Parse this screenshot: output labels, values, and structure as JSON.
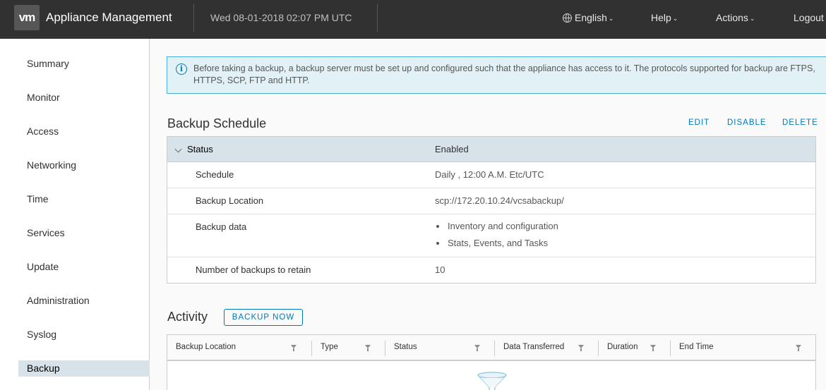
{
  "header": {
    "logo": "vm",
    "app_title": "Appliance Management",
    "datetime": "Wed 08-01-2018 02:07 PM UTC",
    "nav": {
      "language": "English",
      "help": "Help",
      "actions": "Actions",
      "logout": "Logout"
    }
  },
  "sidebar": {
    "items": [
      {
        "label": "Summary"
      },
      {
        "label": "Monitor"
      },
      {
        "label": "Access"
      },
      {
        "label": "Networking"
      },
      {
        "label": "Time"
      },
      {
        "label": "Services"
      },
      {
        "label": "Update"
      },
      {
        "label": "Administration"
      },
      {
        "label": "Syslog"
      },
      {
        "label": "Backup"
      }
    ],
    "active": "Backup"
  },
  "alert": {
    "text": "Before taking a backup, a backup server must be set up and configured such that the appliance has access to it. The protocols supported for backup are FTPS, HTTPS, SCP, FTP and HTTP."
  },
  "backup_schedule": {
    "title": "Backup Schedule",
    "actions": {
      "edit": "EDIT",
      "disable": "DISABLE",
      "delete": "DELETE"
    },
    "status_label": "Status",
    "status_value": "Enabled",
    "rows": {
      "schedule": {
        "label": "Schedule",
        "value": "Daily , 12:00 A.M. Etc/UTC"
      },
      "location": {
        "label": "Backup Location",
        "value": "scp://172.20.10.24/vcsabackup/"
      },
      "data": {
        "label": "Backup data",
        "values": [
          "Inventory and configuration",
          "Stats, Events, and Tasks"
        ]
      },
      "retain": {
        "label": "Number of backups to retain",
        "value": "10"
      }
    }
  },
  "activity": {
    "title": "Activity",
    "backup_now": "BACKUP NOW",
    "columns": [
      "Backup Location",
      "Type",
      "Status",
      "Data Transferred",
      "Duration",
      "End Time"
    ]
  },
  "colors": {
    "header_bg": "#313131",
    "accent": "#0079b8",
    "active_nav": "#d8e3e9",
    "alert_bg": "#e1f1f6"
  }
}
